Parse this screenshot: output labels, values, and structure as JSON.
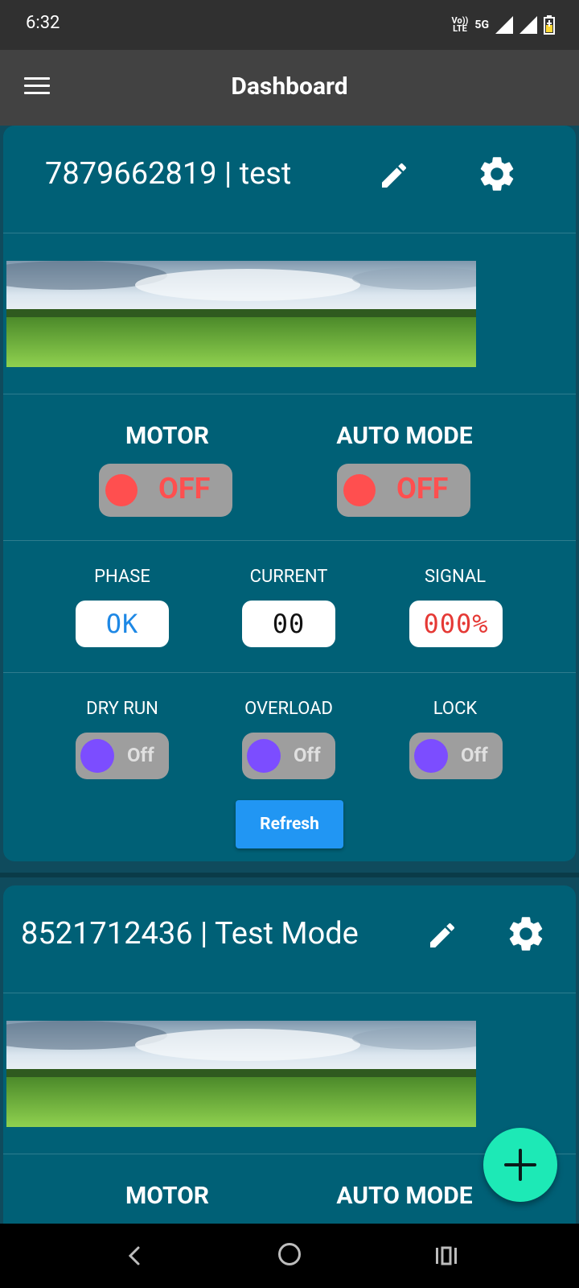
{
  "status": {
    "time": "6:32",
    "volte": "Vo))\nLTE",
    "net": "5G"
  },
  "appbar": {
    "title": "Dashboard"
  },
  "cards": [
    {
      "title": "7879662819 | test",
      "motor_label": "MOTOR",
      "motor_state": "OFF",
      "auto_label": "AUTO MODE",
      "auto_state": "OFF",
      "phase_label": "PHASE",
      "phase_value": "OK",
      "current_label": "CURRENT",
      "current_value": "00",
      "signal_label": "SIGNAL",
      "signal_value": "000%",
      "dryrun_label": "DRY RUN",
      "dryrun_state": "Off",
      "overload_label": "OVERLOAD",
      "overload_state": "Off",
      "lock_label": "LOCK",
      "lock_state": "Off",
      "refresh_label": "Refresh"
    },
    {
      "title": "8521712436 | Test Mode",
      "motor_label": "MOTOR",
      "auto_label": "AUTO MODE"
    }
  ],
  "colors": {
    "card_bg": "#006076",
    "toggle_off_red": "#ff4f4f",
    "knob_purple": "#7c4dff",
    "phase_blue": "#1e88e5",
    "signal_red": "#e53935",
    "refresh_blue": "#2196f3",
    "fab_teal": "#1de9b6"
  },
  "icons": [
    "menu-icon",
    "edit-icon",
    "gear-icon",
    "plus-icon",
    "back-icon",
    "home-icon",
    "recents-icon"
  ]
}
